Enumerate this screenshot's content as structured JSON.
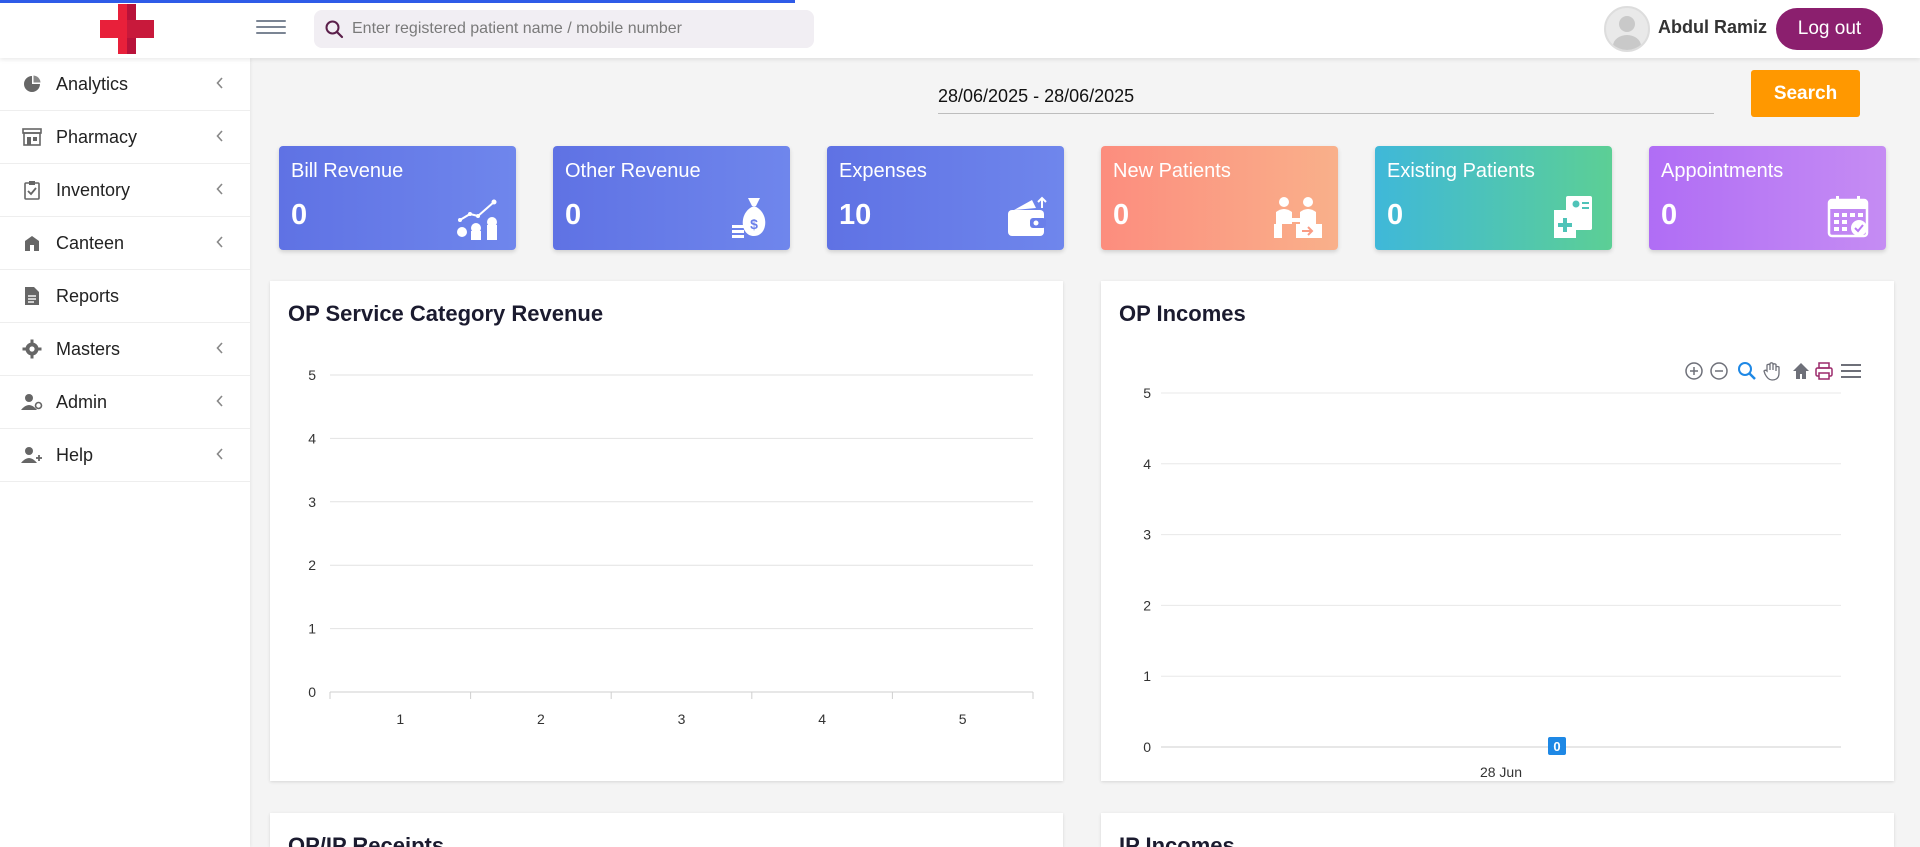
{
  "header": {
    "search_placeholder": "Enter registered patient name / mobile number",
    "username": "Abdul Ramiz",
    "logout_label": "Log out"
  },
  "sidebar": {
    "items": [
      {
        "label": "Analytics",
        "icon": "pie-chart-icon"
      },
      {
        "label": "Pharmacy",
        "icon": "store-icon"
      },
      {
        "label": "Inventory",
        "icon": "clipboard-check-icon"
      },
      {
        "label": "Canteen",
        "icon": "building-icon"
      },
      {
        "label": "Reports",
        "icon": "document-icon"
      },
      {
        "label": "Masters",
        "icon": "gear-icon"
      },
      {
        "label": "Admin",
        "icon": "user-gear-icon"
      },
      {
        "label": "Help",
        "icon": "user-plus-icon"
      }
    ]
  },
  "filter": {
    "date_range": "28/06/2025 - 28/06/2025",
    "search_label": "Search"
  },
  "cards": [
    {
      "title": "Bill Revenue",
      "value": "0",
      "color_from": "#5f72e4",
      "color_to": "#6f86ec",
      "icon": "growth-coins-icon"
    },
    {
      "title": "Other Revenue",
      "value": "0",
      "color_from": "#5f72e4",
      "color_to": "#6f86ec",
      "icon": "money-bag-icon"
    },
    {
      "title": "Expenses",
      "value": "10",
      "color_from": "#5f72e4",
      "color_to": "#6f86ec",
      "icon": "wallet-icon"
    },
    {
      "title": "New Patients",
      "value": "0",
      "color_from": "#fc8d7e",
      "color_to": "#f9b08a",
      "icon": "consultation-icon"
    },
    {
      "title": "Existing Patients",
      "value": "0",
      "color_from": "#3fb8d9",
      "color_to": "#5ccf95",
      "icon": "medical-record-icon"
    },
    {
      "title": "Appointments",
      "value": "0",
      "color_from": "#b06df5",
      "color_to": "#c58cf3",
      "icon": "calendar-check-icon"
    }
  ],
  "panels": {
    "op_service_title": "OP Service Category Revenue",
    "op_incomes_title": "OP Incomes",
    "opip_receipts_title": "OP/IP Receipts",
    "ip_incomes_title": "IP Incomes"
  },
  "chart_data": [
    {
      "type": "bar",
      "title": "OP Service Category Revenue",
      "categories": [
        "1",
        "2",
        "3",
        "4",
        "5"
      ],
      "values": [],
      "y_ticks": [
        "0",
        "1",
        "2",
        "3",
        "4",
        "5"
      ],
      "ylim": [
        0,
        5
      ],
      "grid": true
    },
    {
      "type": "bar",
      "title": "OP Incomes",
      "categories": [
        "28 Jun"
      ],
      "values": [
        0
      ],
      "data_labels": [
        "0"
      ],
      "y_ticks": [
        "0",
        "1",
        "2",
        "3",
        "4",
        "5"
      ],
      "ylim": [
        0,
        5
      ],
      "grid": true,
      "label_color": "#1e88e5"
    }
  ]
}
